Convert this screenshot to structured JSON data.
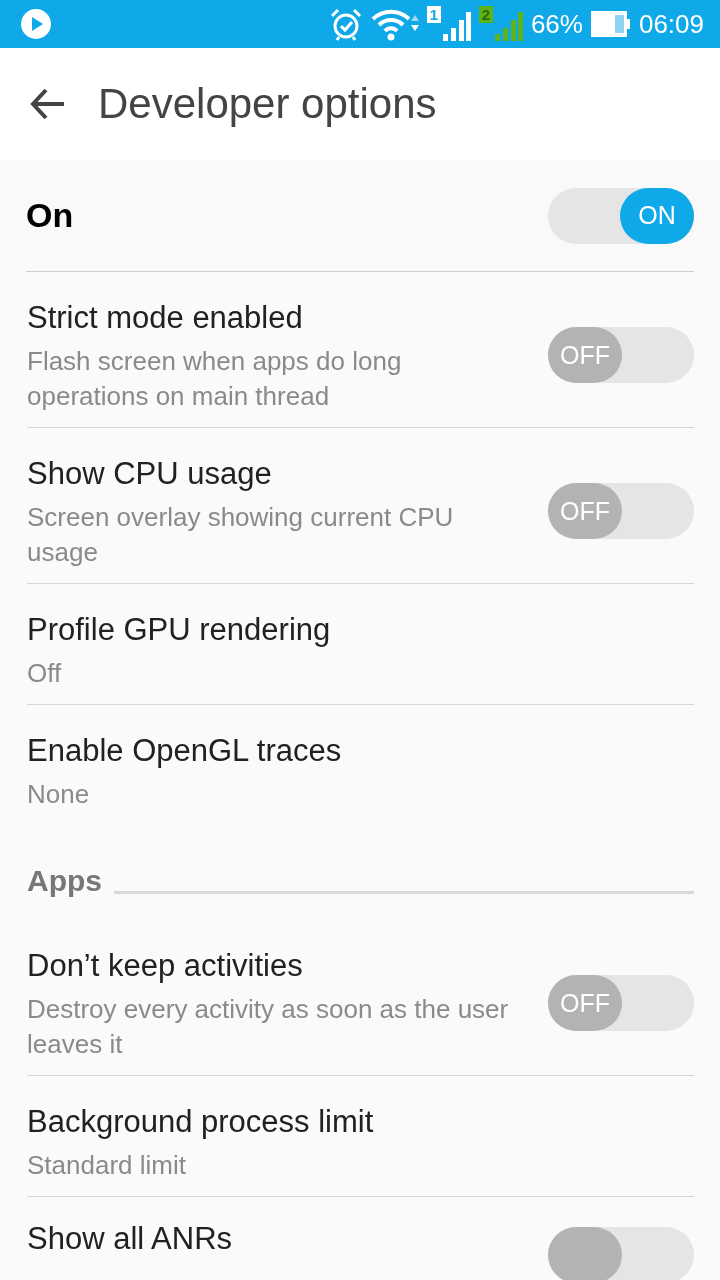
{
  "status_bar": {
    "battery_percent": "66%",
    "time": "06:09",
    "sim_1": "1",
    "sim_2": "2"
  },
  "header": {
    "title": "Developer options"
  },
  "master_switch": {
    "label": "On",
    "on": true,
    "state_label": "ON"
  },
  "items": [
    {
      "kind": "switch",
      "title": "Strict mode enabled",
      "summary": "Flash screen when apps do long operations on main thread",
      "on": false,
      "state_label": "OFF"
    },
    {
      "kind": "switch",
      "title": "Show CPU usage",
      "summary": "Screen overlay showing current CPU usage",
      "on": false,
      "state_label": "OFF"
    },
    {
      "kind": "value",
      "title": "Profile GPU rendering",
      "summary": "Off"
    },
    {
      "kind": "value",
      "title": "Enable OpenGL traces",
      "summary": "None"
    },
    {
      "kind": "category",
      "title": "Apps"
    },
    {
      "kind": "switch",
      "title": "Don’t keep activities",
      "summary": "Destroy every activity as soon as the user leaves it",
      "on": false,
      "state_label": "OFF"
    },
    {
      "kind": "value",
      "title": "Background process limit",
      "summary": "Standard limit"
    },
    {
      "kind": "switch",
      "title": "Show all ANRs",
      "on": false
    }
  ]
}
